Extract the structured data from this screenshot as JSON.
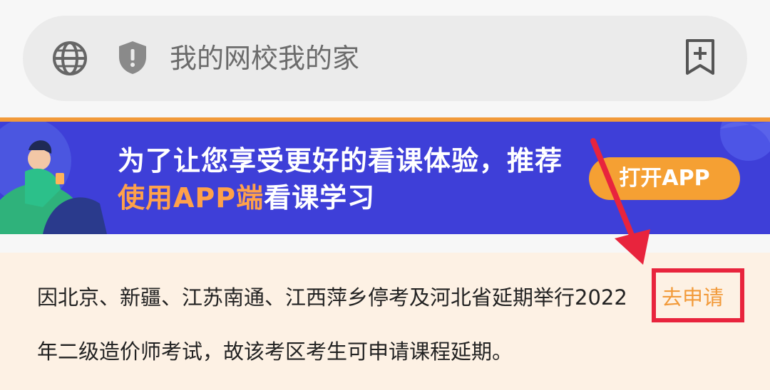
{
  "browser": {
    "url_text": "我的网校我的家",
    "icons": [
      "globe-icon",
      "shield-icon",
      "bookmark-add-icon"
    ]
  },
  "banner": {
    "line1": "为了让您享受更好的看课体验，推荐",
    "line2_highlight": "使用APP端",
    "line2_rest": "看课学习",
    "open_app_label": "打开APP"
  },
  "notice": {
    "line1": "因北京、新疆、江苏南通、江西萍乡停考及河北省延期举行2022",
    "line2": "年二级造价师考试，故该考区考生可申请课程延期。",
    "apply_link": "去申请"
  },
  "colors": {
    "accent_orange": "#f29a3a",
    "banner_blue": "#3e3fd8",
    "annotation_red": "#e8243d"
  }
}
